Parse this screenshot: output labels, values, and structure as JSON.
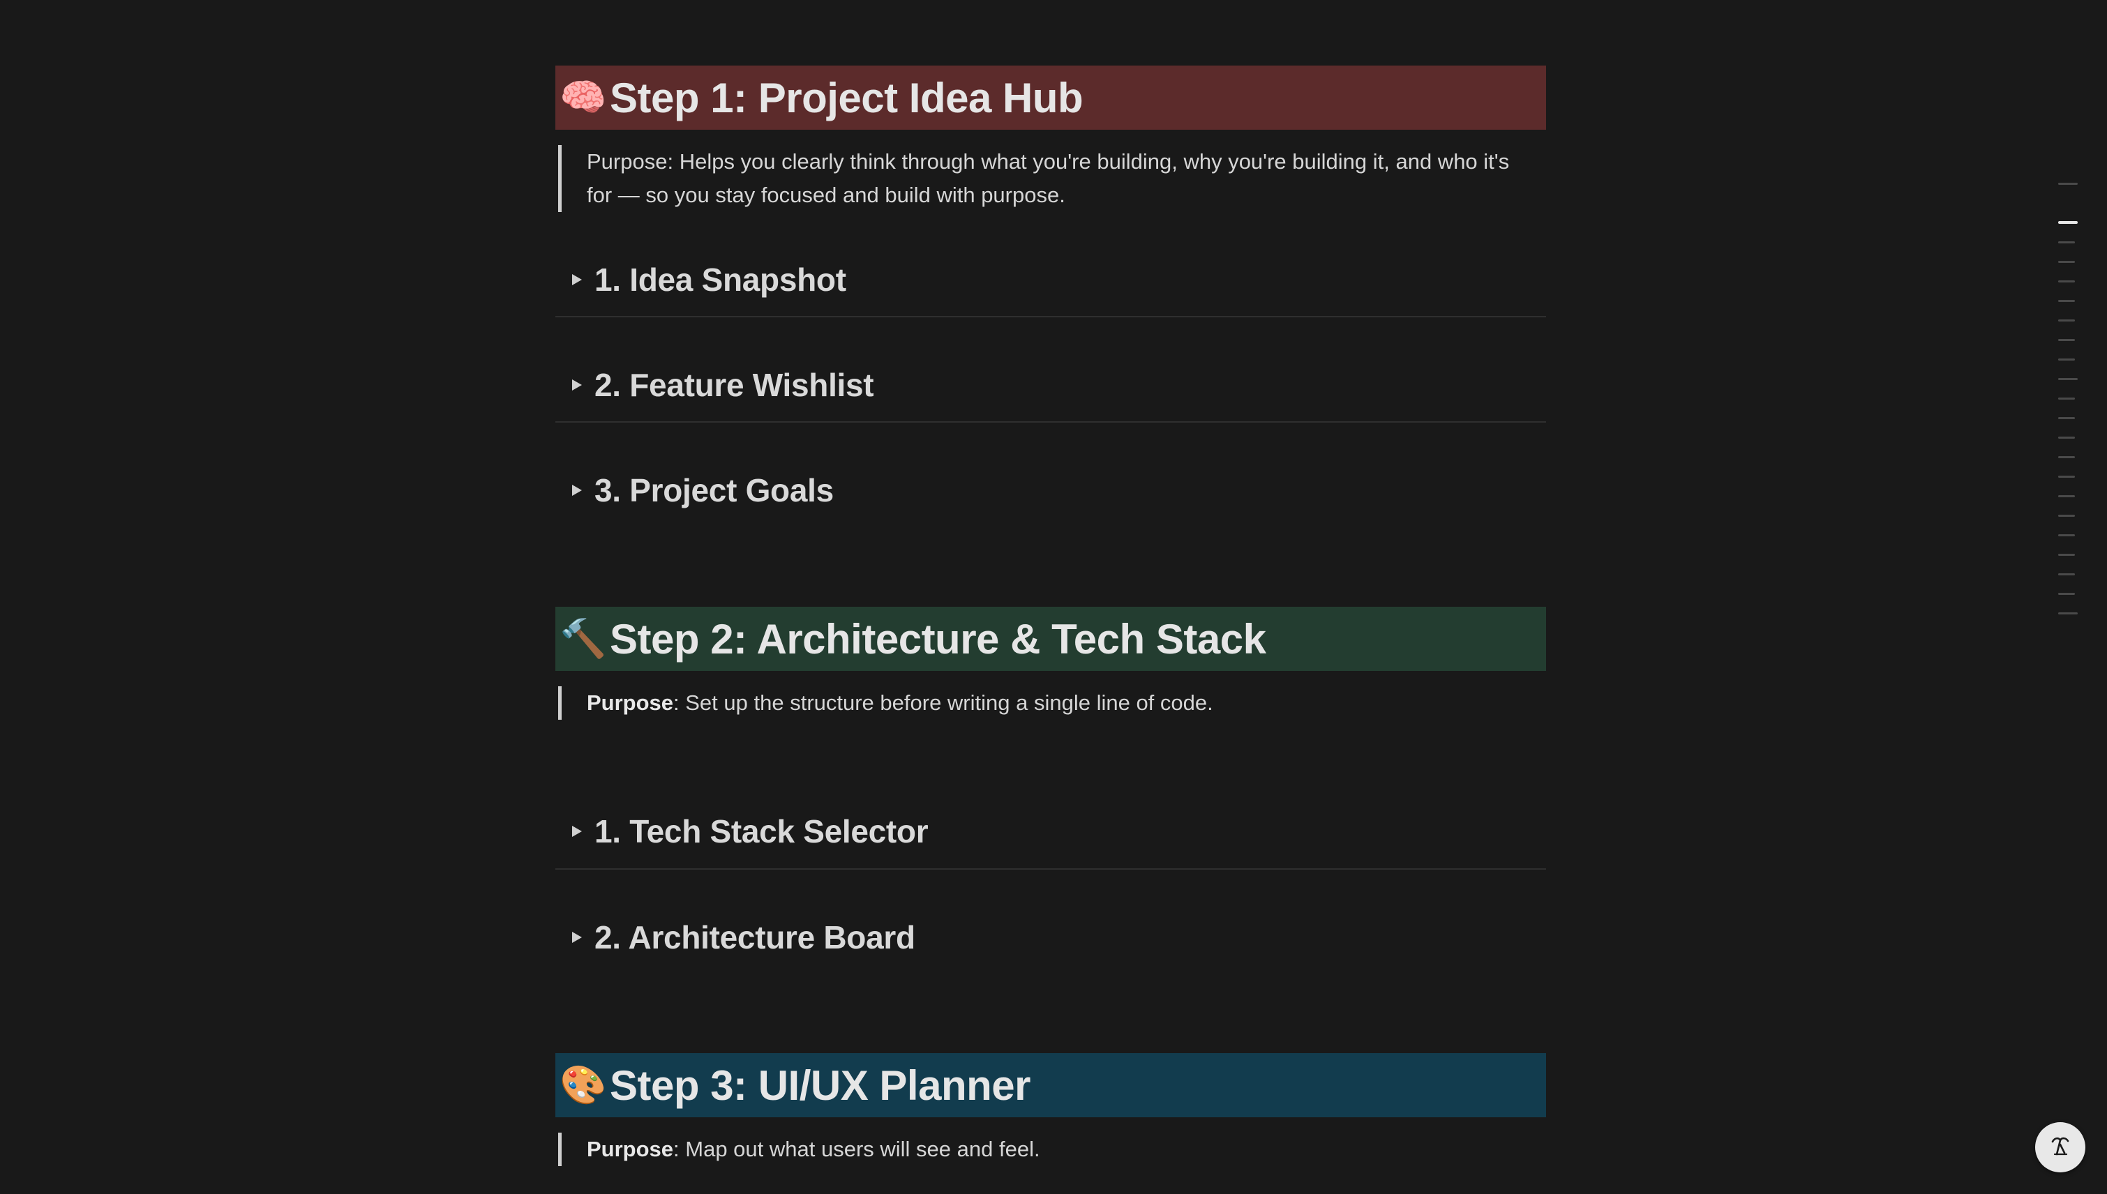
{
  "colors": {
    "background": "#191919",
    "step1_bg": "#5c2b2b",
    "step2_bg": "#233d30",
    "step3_bg": "#123c4e"
  },
  "step1": {
    "emoji": "🧠",
    "emoji_icon": "brain-icon",
    "title": "Step 1: Project Idea Hub",
    "purpose_text": "Purpose: Helps you clearly think through what you're building, why you're building it, and who it's for — so you stay focused and build with purpose.",
    "toggles": [
      {
        "label": "1. Idea Snapshot"
      },
      {
        "label": "2. Feature Wishlist"
      },
      {
        "label": "3. Project Goals"
      }
    ]
  },
  "step2": {
    "emoji": "🔨",
    "emoji_icon": "hammer-icon",
    "title": "Step 2: Architecture & Tech Stack",
    "purpose_label": "Purpose",
    "purpose_text": ": Set up the structure before writing a single line of code.",
    "toggles": [
      {
        "label": "1. Tech Stack Selector"
      },
      {
        "label": "2. Architecture Board"
      }
    ]
  },
  "step3": {
    "emoji": "🎨",
    "emoji_icon": "palette-icon",
    "title": "Step 3: UI/UX Planner",
    "purpose_label": "Purpose",
    "purpose_text": ": Map out what users will see and feel."
  },
  "toc": {
    "active_index": 2
  },
  "help_button": {
    "icon": "help-icon"
  }
}
